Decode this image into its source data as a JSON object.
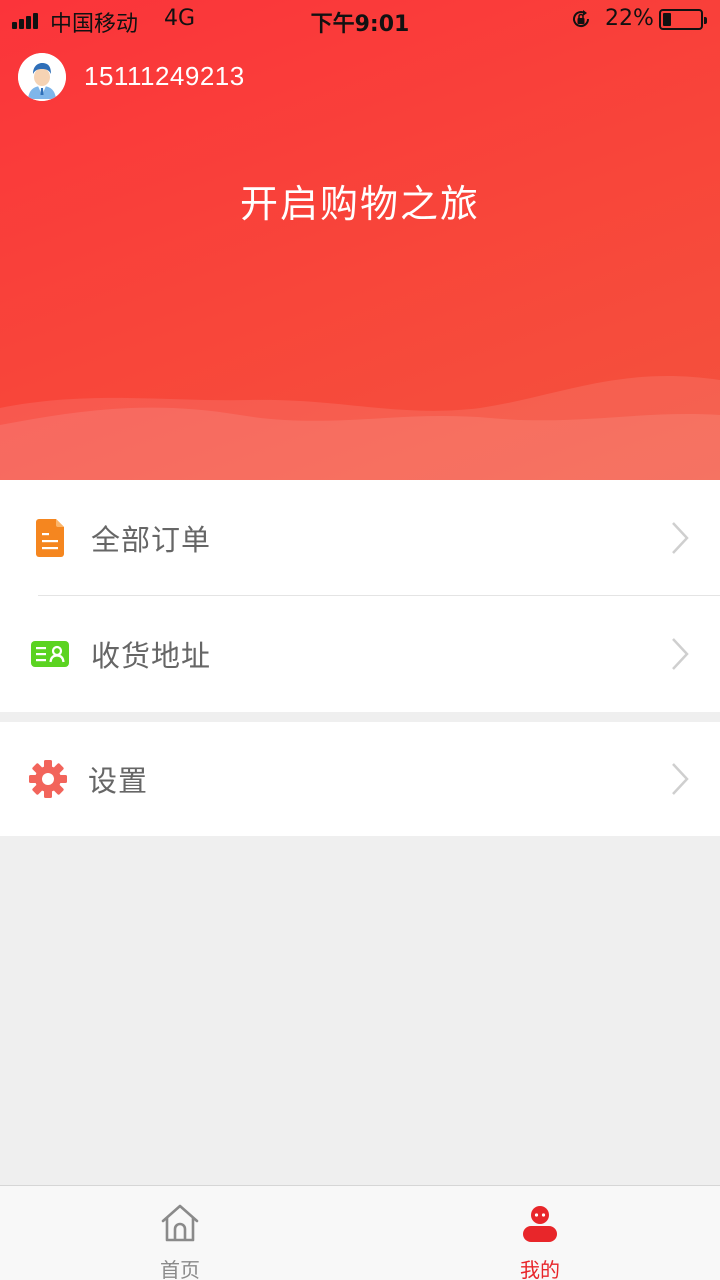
{
  "status_bar": {
    "carrier": "中国移动",
    "network": "4G",
    "time": "下午9:01",
    "battery_percent": "22%",
    "battery_level": 0.22,
    "icons": [
      "signal-icon",
      "orientation-lock-icon",
      "battery-icon"
    ]
  },
  "profile": {
    "phone": "15111249213",
    "avatar_icon": "user-avatar-icon"
  },
  "banner": {
    "slogan": "开启购物之旅"
  },
  "menu": {
    "orders": {
      "label": "全部订单",
      "icon": "document-icon",
      "color": "#f5861f"
    },
    "address": {
      "label": "收货地址",
      "icon": "address-card-icon",
      "color": "#5bd321"
    },
    "settings": {
      "label": "设置",
      "icon": "gear-icon",
      "color": "#f2645b"
    }
  },
  "tabbar": {
    "home": {
      "label": "首页",
      "icon": "home-icon",
      "color": "#8a8a8a"
    },
    "mine": {
      "label": "我的",
      "icon": "profile-icon",
      "color": "#e8262a",
      "active": true
    }
  },
  "colors": {
    "header_gradient": [
      "#fb343a",
      "#f3533e"
    ],
    "background": "#efefef",
    "accent": "#e8262a"
  }
}
